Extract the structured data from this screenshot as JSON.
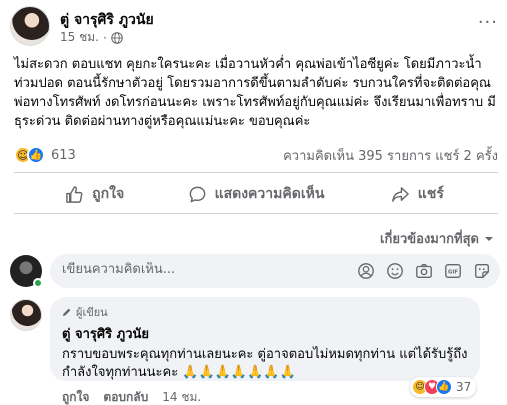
{
  "post": {
    "author": "ตู่ จารุศิริ ภูวนัย",
    "time": "15 ชม.",
    "more_label": "···",
    "body": "ไม่สะดวก ตอบแชท คุยกะใครนะคะ เมื่อวานหัวค่ำ คุณพ่อเข้าไอซียูค่ะ โดยมีภาวะน้ำท่วมปอด ตอนนี้รักษาตัวอยู่ โดยรวมอาการดีขึ้นตามลำดับค่ะ รบกวนใครที่จะติดต่อคุณพ่อทางโทรศัพท์ งดโทรก่อนนะคะ เพราะโทรศัพท์อยู่กับคุณแม่ค่ะ จึงเรียนมาเพื่อทราบ มีธุระด่วน ติดต่อผ่านทางตู่หรือคุณแม่นะคะ ขอบคุณค่ะ"
  },
  "reactions": {
    "count": "613",
    "stats": "ความคิดเห็น 395 รายการ  แชร์ 2 ครั้ง"
  },
  "actions": {
    "like": "ถูกใจ",
    "comment": "แสดงความคิดเห็น",
    "share": "แชร์"
  },
  "sort": {
    "label": "เกี่ยวข้องมากที่สุด"
  },
  "composer": {
    "placeholder": "เขียนความคิดเห็น..."
  },
  "comment": {
    "badge": "ผู้เขียน",
    "author": "ตู่ จารุศิริ ภูวนัย",
    "text": "กราบขอบพระคุณทุกท่านเลยนะคะ ตู่อาจตอบไม่หมดทุกท่าน แต่ได้รับรู้ถึงกำลังใจทุกท่านนะคะ 🙏🙏🙏🙏🙏🙏🙏",
    "react_count": "37",
    "like": "ถูกใจ",
    "reply": "ตอบกลับ",
    "time": "14 ชม."
  },
  "colors": {
    "accent": "#1877f2",
    "muted": "#65676b",
    "bubble": "#f0f2f5"
  }
}
